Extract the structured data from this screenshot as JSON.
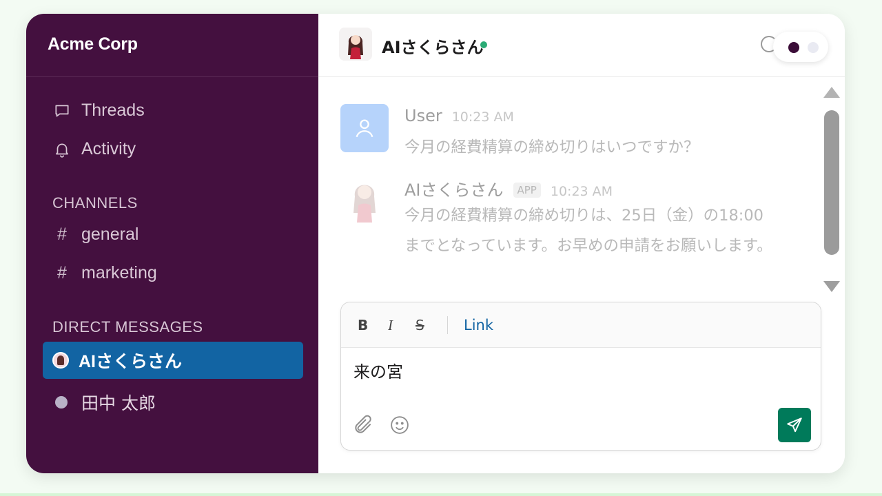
{
  "workspace": {
    "name": "Acme Corp"
  },
  "sidebar": {
    "nav": [
      {
        "label": "Threads",
        "icon": "threads-icon"
      },
      {
        "label": "Activity",
        "icon": "bell-icon"
      }
    ],
    "channels_title": "CHANNELS",
    "channels": [
      {
        "label": "general"
      },
      {
        "label": "marketing"
      }
    ],
    "dm_title": "DIRECT MESSAGES",
    "dms": [
      {
        "label": "AIさくらさん",
        "active": true
      },
      {
        "label": "田中 太郎",
        "active": false
      }
    ],
    "hash": "#"
  },
  "header": {
    "name": "AIさくらさん",
    "status": "online"
  },
  "messages": [
    {
      "author": "User",
      "time": "10:23 AM",
      "lines": [
        "今月の経費精算の締め切りはいつですか？"
      ]
    },
    {
      "author": "AIさくらさん",
      "badge": "APP",
      "time": "10:23 AM",
      "lines": [
        "今月の経費精算の締め切りは、25日（金）の18:00",
        "までとなっています。お早めの申請をお願いします。"
      ]
    }
  ],
  "composer": {
    "bold": "B",
    "italic": "I",
    "strike": "S",
    "link": "Link",
    "value": "来の宮"
  },
  "colors": {
    "sidebar_bg": "#44103f",
    "active_dm": "#1264a3",
    "send_button": "#007a5a",
    "online": "#2bac76"
  }
}
